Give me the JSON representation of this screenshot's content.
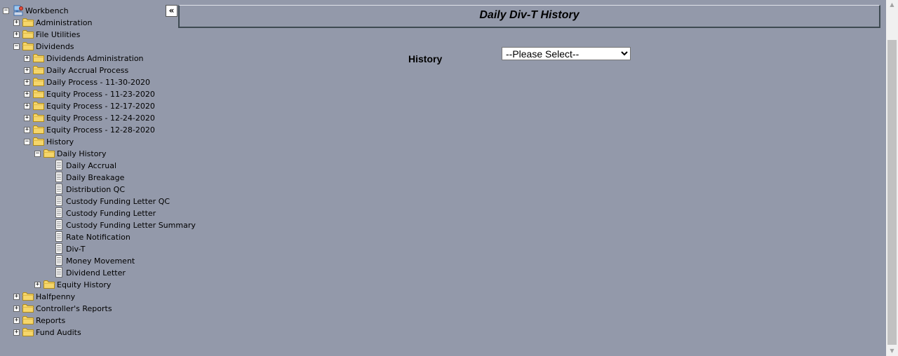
{
  "tree": {
    "collapse_label": "«",
    "items": [
      {
        "label": "Workbench",
        "level": 0,
        "type": "root",
        "expander": "minus"
      },
      {
        "label": "Administration",
        "level": 1,
        "type": "folder",
        "expander": "plus"
      },
      {
        "label": "File Utilities",
        "level": 1,
        "type": "folder",
        "expander": "plus"
      },
      {
        "label": "Dividends",
        "level": 1,
        "type": "folder",
        "expander": "minus"
      },
      {
        "label": "Dividends Administration",
        "level": 2,
        "type": "folder",
        "expander": "plus"
      },
      {
        "label": "Daily Accrual Process",
        "level": 2,
        "type": "folder",
        "expander": "plus"
      },
      {
        "label": "Daily Process - 11-30-2020",
        "level": 2,
        "type": "folder",
        "expander": "plus"
      },
      {
        "label": "Equity Process - 11-23-2020",
        "level": 2,
        "type": "folder",
        "expander": "plus"
      },
      {
        "label": "Equity Process - 12-17-2020",
        "level": 2,
        "type": "folder",
        "expander": "plus"
      },
      {
        "label": "Equity Process - 12-24-2020",
        "level": 2,
        "type": "folder",
        "expander": "plus"
      },
      {
        "label": "Equity Process - 12-28-2020",
        "level": 2,
        "type": "folder",
        "expander": "plus"
      },
      {
        "label": "History",
        "level": 2,
        "type": "folder",
        "expander": "minus"
      },
      {
        "label": "Daily History",
        "level": 3,
        "type": "folder",
        "expander": "minus"
      },
      {
        "label": "Daily Accrual",
        "level": 4,
        "type": "doc",
        "expander": ""
      },
      {
        "label": "Daily Breakage",
        "level": 4,
        "type": "doc",
        "expander": ""
      },
      {
        "label": "Distribution QC",
        "level": 4,
        "type": "doc",
        "expander": ""
      },
      {
        "label": "Custody Funding Letter QC",
        "level": 4,
        "type": "doc",
        "expander": ""
      },
      {
        "label": "Custody Funding Letter",
        "level": 4,
        "type": "doc",
        "expander": ""
      },
      {
        "label": "Custody Funding Letter Summary",
        "level": 4,
        "type": "doc",
        "expander": ""
      },
      {
        "label": "Rate Notification",
        "level": 4,
        "type": "doc",
        "expander": ""
      },
      {
        "label": "Div-T",
        "level": 4,
        "type": "doc",
        "expander": ""
      },
      {
        "label": "Money Movement",
        "level": 4,
        "type": "doc",
        "expander": ""
      },
      {
        "label": "Dividend Letter",
        "level": 4,
        "type": "doc",
        "expander": ""
      },
      {
        "label": "Equity History",
        "level": 3,
        "type": "folder",
        "expander": "plus"
      },
      {
        "label": "Halfpenny",
        "level": 1,
        "type": "folder",
        "expander": "plus"
      },
      {
        "label": "Controller's Reports",
        "level": 1,
        "type": "folder",
        "expander": "plus"
      },
      {
        "label": "Reports",
        "level": 1,
        "type": "folder",
        "expander": "plus"
      },
      {
        "label": "Fund Audits",
        "level": 1,
        "type": "folder",
        "expander": "plus"
      }
    ]
  },
  "header": {
    "title": "Daily Div-T History"
  },
  "form": {
    "history_label": "History",
    "history_select": {
      "selected": "--Please Select--",
      "options": [
        "--Please Select--"
      ]
    }
  },
  "colors": {
    "background": "#9399aa",
    "header_border": "#3e4a52",
    "folder_fill": "#f5d66b",
    "folder_stroke": "#b08a18"
  }
}
